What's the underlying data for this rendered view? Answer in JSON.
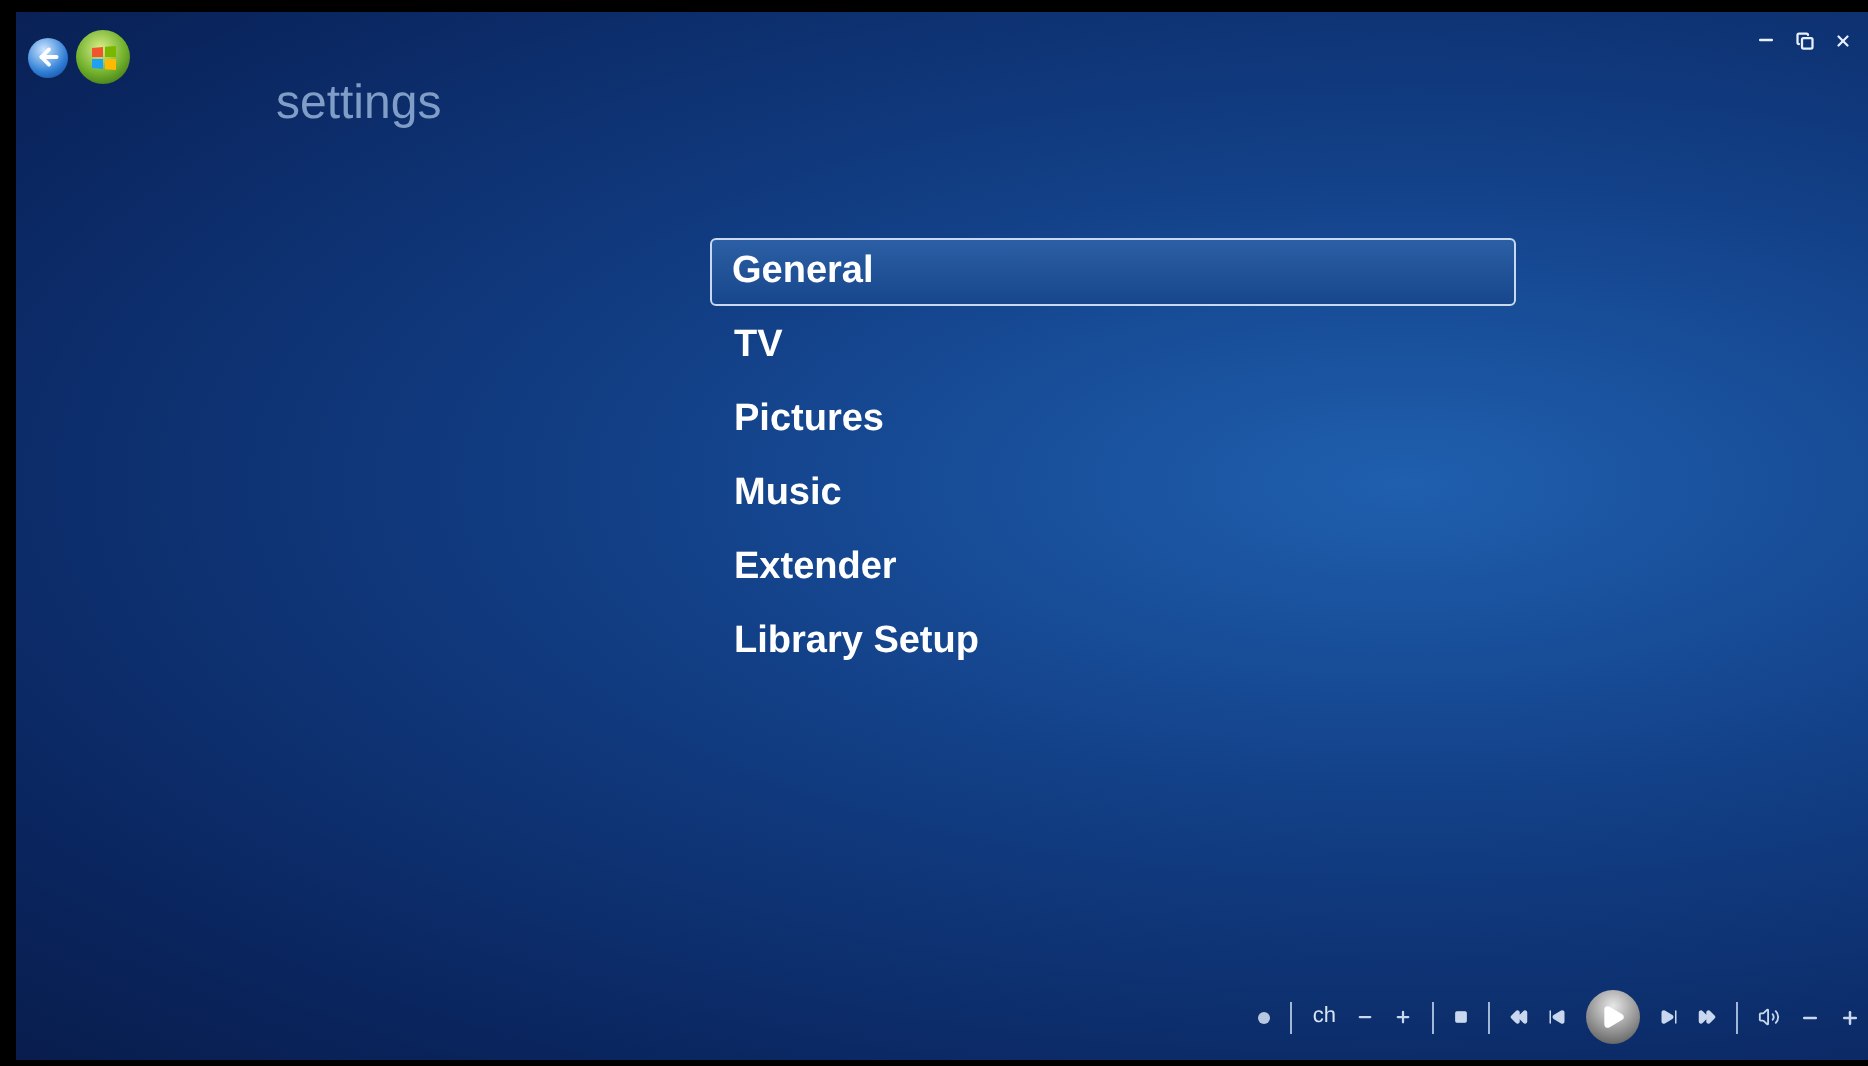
{
  "page_title": "settings",
  "menu": [
    {
      "label": "General",
      "selected": true
    },
    {
      "label": "TV",
      "selected": false
    },
    {
      "label": "Pictures",
      "selected": false
    },
    {
      "label": "Music",
      "selected": false
    },
    {
      "label": "Extender",
      "selected": false
    },
    {
      "label": "Library Setup",
      "selected": false
    }
  ],
  "transport": {
    "channel_label": "ch"
  }
}
